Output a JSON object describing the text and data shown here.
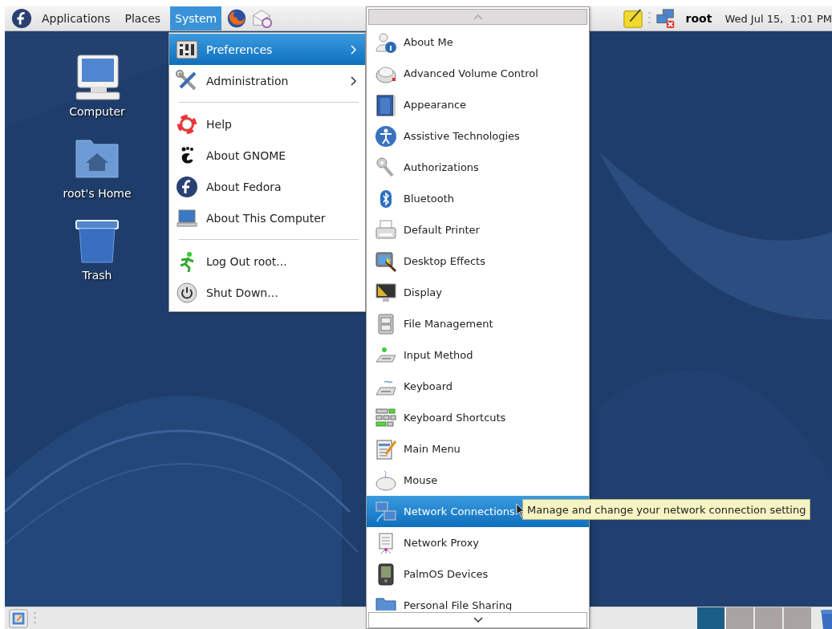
{
  "top_panel": {
    "menus": [
      {
        "label": "Applications",
        "selected": false
      },
      {
        "label": "Places",
        "selected": false
      },
      {
        "label": "System",
        "selected": true
      }
    ],
    "user": "root",
    "clock": "Wed Jul 15,  1:01 PM"
  },
  "desktop_icons": [
    {
      "label": "Computer",
      "kind": "computer"
    },
    {
      "label": "root's Home",
      "kind": "home"
    },
    {
      "label": "Trash",
      "kind": "trash"
    }
  ],
  "system_menu": {
    "groups": [
      [
        {
          "label": "Preferences",
          "kind": "preferences",
          "submenu": true,
          "selected": true
        },
        {
          "label": "Administration",
          "kind": "administration",
          "submenu": true,
          "selected": false
        }
      ],
      [
        {
          "label": "Help",
          "kind": "help",
          "submenu": false,
          "selected": false
        },
        {
          "label": "About GNOME",
          "kind": "gnome",
          "submenu": false,
          "selected": false
        },
        {
          "label": "About Fedora",
          "kind": "fedora",
          "submenu": false,
          "selected": false
        },
        {
          "label": "About This Computer",
          "kind": "laptop",
          "submenu": false,
          "selected": false
        }
      ],
      [
        {
          "label": "Log Out root...",
          "kind": "logout",
          "submenu": false,
          "selected": false
        },
        {
          "label": "Shut Down...",
          "kind": "shutdown",
          "submenu": false,
          "selected": false
        }
      ]
    ]
  },
  "preferences_menu": {
    "items": [
      {
        "label": "About Me",
        "kind": "aboutme",
        "selected": false
      },
      {
        "label": "Advanced Volume Control",
        "kind": "volume",
        "selected": false
      },
      {
        "label": "Appearance",
        "kind": "appearance",
        "selected": false
      },
      {
        "label": "Assistive Technologies",
        "kind": "accessibility",
        "selected": false
      },
      {
        "label": "Authorizations",
        "kind": "keys",
        "selected": false
      },
      {
        "label": "Bluetooth",
        "kind": "bluetooth",
        "selected": false
      },
      {
        "label": "Default Printer",
        "kind": "printer",
        "selected": false
      },
      {
        "label": "Desktop Effects",
        "kind": "effects",
        "selected": false
      },
      {
        "label": "Display",
        "kind": "display",
        "selected": false
      },
      {
        "label": "File Management",
        "kind": "cabinet",
        "selected": false
      },
      {
        "label": "Input Method",
        "kind": "inputmethod",
        "selected": false
      },
      {
        "label": "Keyboard",
        "kind": "keyboard",
        "selected": false
      },
      {
        "label": "Keyboard Shortcuts",
        "kind": "shortcuts",
        "selected": false
      },
      {
        "label": "Main Menu",
        "kind": "mainmenu",
        "selected": false
      },
      {
        "label": "Mouse",
        "kind": "mouse",
        "selected": false
      },
      {
        "label": "Network Connections",
        "kind": "network",
        "selected": true
      },
      {
        "label": "Network Proxy",
        "kind": "proxy",
        "selected": false
      },
      {
        "label": "PalmOS Devices",
        "kind": "palm",
        "selected": false
      },
      {
        "label": "Personal File Sharing",
        "kind": "folder",
        "selected": false
      }
    ]
  },
  "tooltip": "Manage and change your network connection setting",
  "bottom_panel": {
    "workspaces": [
      {
        "selected": true
      },
      {
        "selected": false
      },
      {
        "selected": false
      },
      {
        "selected": false
      }
    ]
  }
}
